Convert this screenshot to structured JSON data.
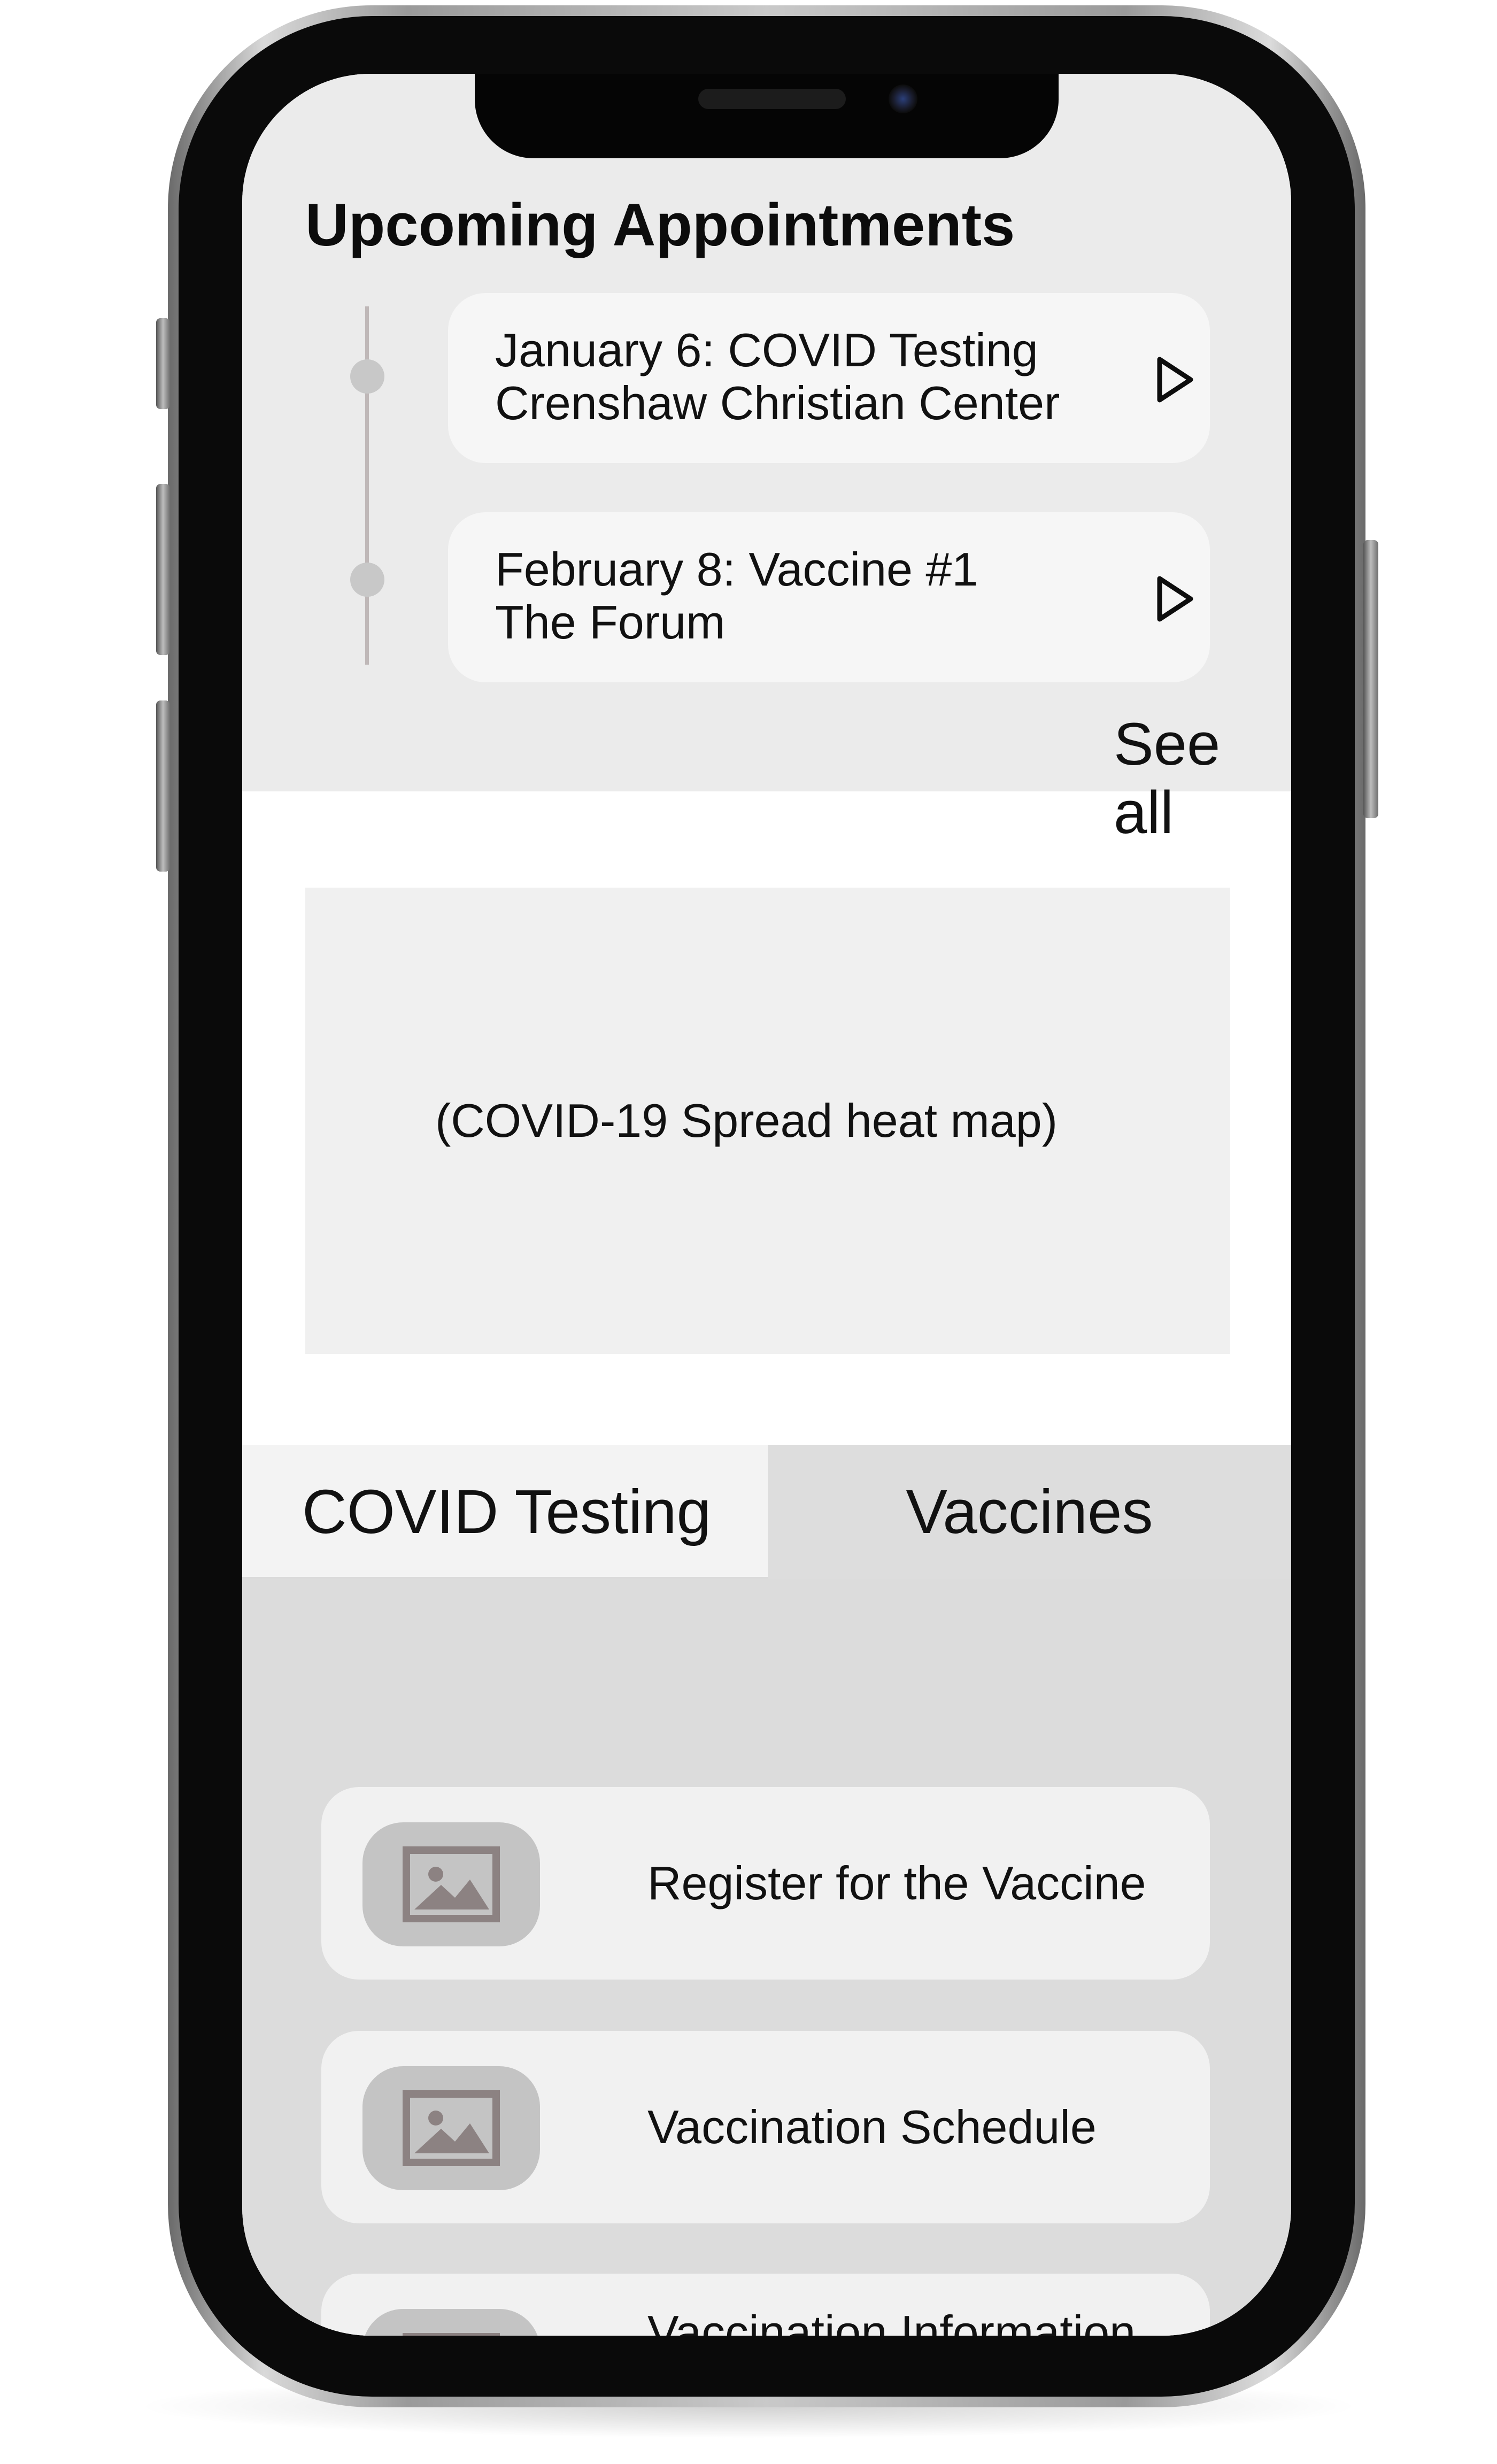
{
  "appointments": {
    "title": "Upcoming Appointments",
    "items": [
      {
        "line1": "January 6: COVID Testing",
        "line2": "Crenshaw Christian Center"
      },
      {
        "line1": "February 8: Vaccine #1",
        "line2": "The Forum"
      }
    ],
    "see_all_line1": "See",
    "see_all_line2": "all"
  },
  "map": {
    "placeholder": "(COVID-19 Spread heat map)"
  },
  "tabs": [
    {
      "label": "COVID Testing",
      "selected": false
    },
    {
      "label": "Vaccines",
      "selected": true
    }
  ],
  "vaccine_options": [
    {
      "label": "Register for the Vaccine",
      "icon": "image-placeholder-icon"
    },
    {
      "label": "Vaccination Schedule",
      "icon": "image-placeholder-icon"
    },
    {
      "label": "Vaccination Information",
      "icon": "image-placeholder-icon"
    }
  ],
  "colors": {
    "screen_background": "#ebebeb",
    "card_background": "#f6f6f6",
    "selected_tab": "#dddddd",
    "list_background": "#dcdcdc",
    "thumbnail": "#c4c4c4",
    "thumbnail_glyph": "#8c8282"
  }
}
